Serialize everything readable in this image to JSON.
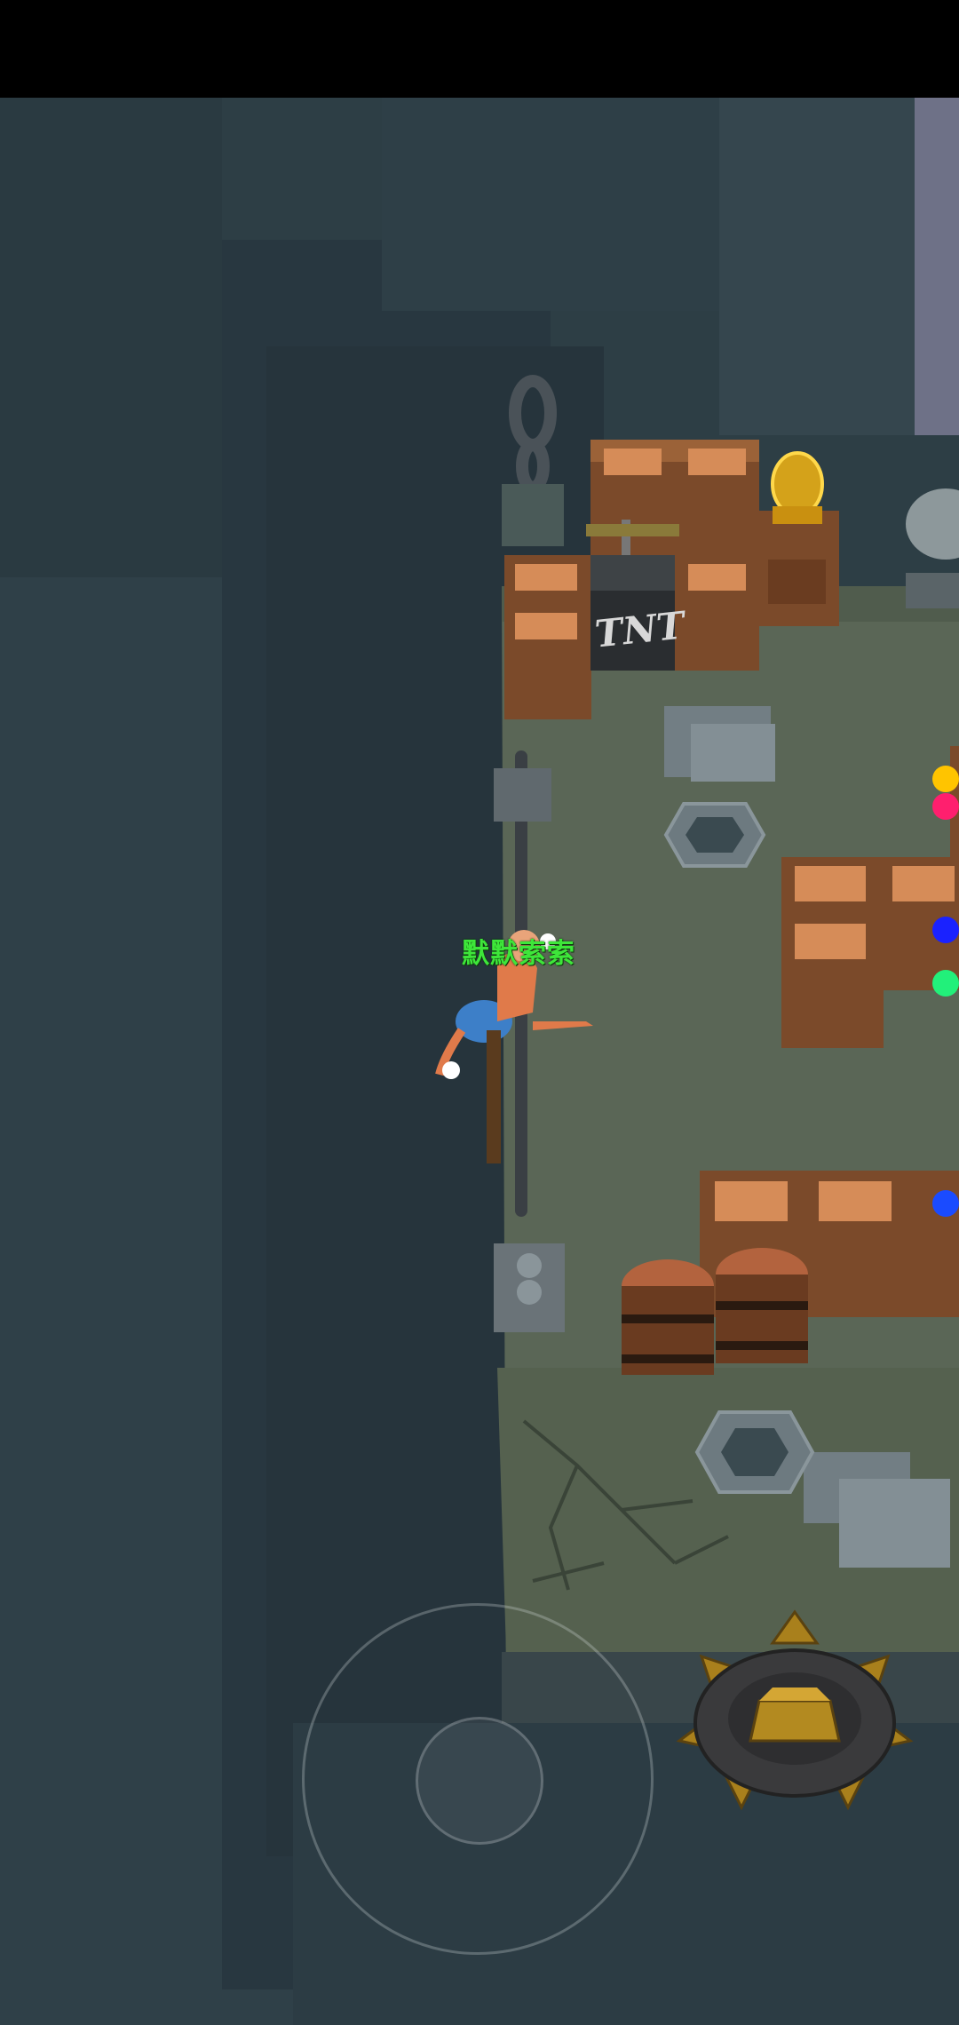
{
  "status_bar": {},
  "game": {
    "player_name": "默默索索",
    "tnt_label": "TNT"
  },
  "indicators": [
    {
      "name": "yellow-player-indicator",
      "color": "#ffc400"
    },
    {
      "name": "pink-player-indicator",
      "color": "#ff1f6e"
    },
    {
      "name": "blue-player-indicator",
      "color": "#1a22ff"
    },
    {
      "name": "green-player-indicator",
      "color": "#22f07a"
    },
    {
      "name": "blue-player-indicator-2",
      "color": "#1a4bff"
    }
  ],
  "controls": {
    "joystick": "virtual-joystick",
    "action": "gear-action-button"
  }
}
